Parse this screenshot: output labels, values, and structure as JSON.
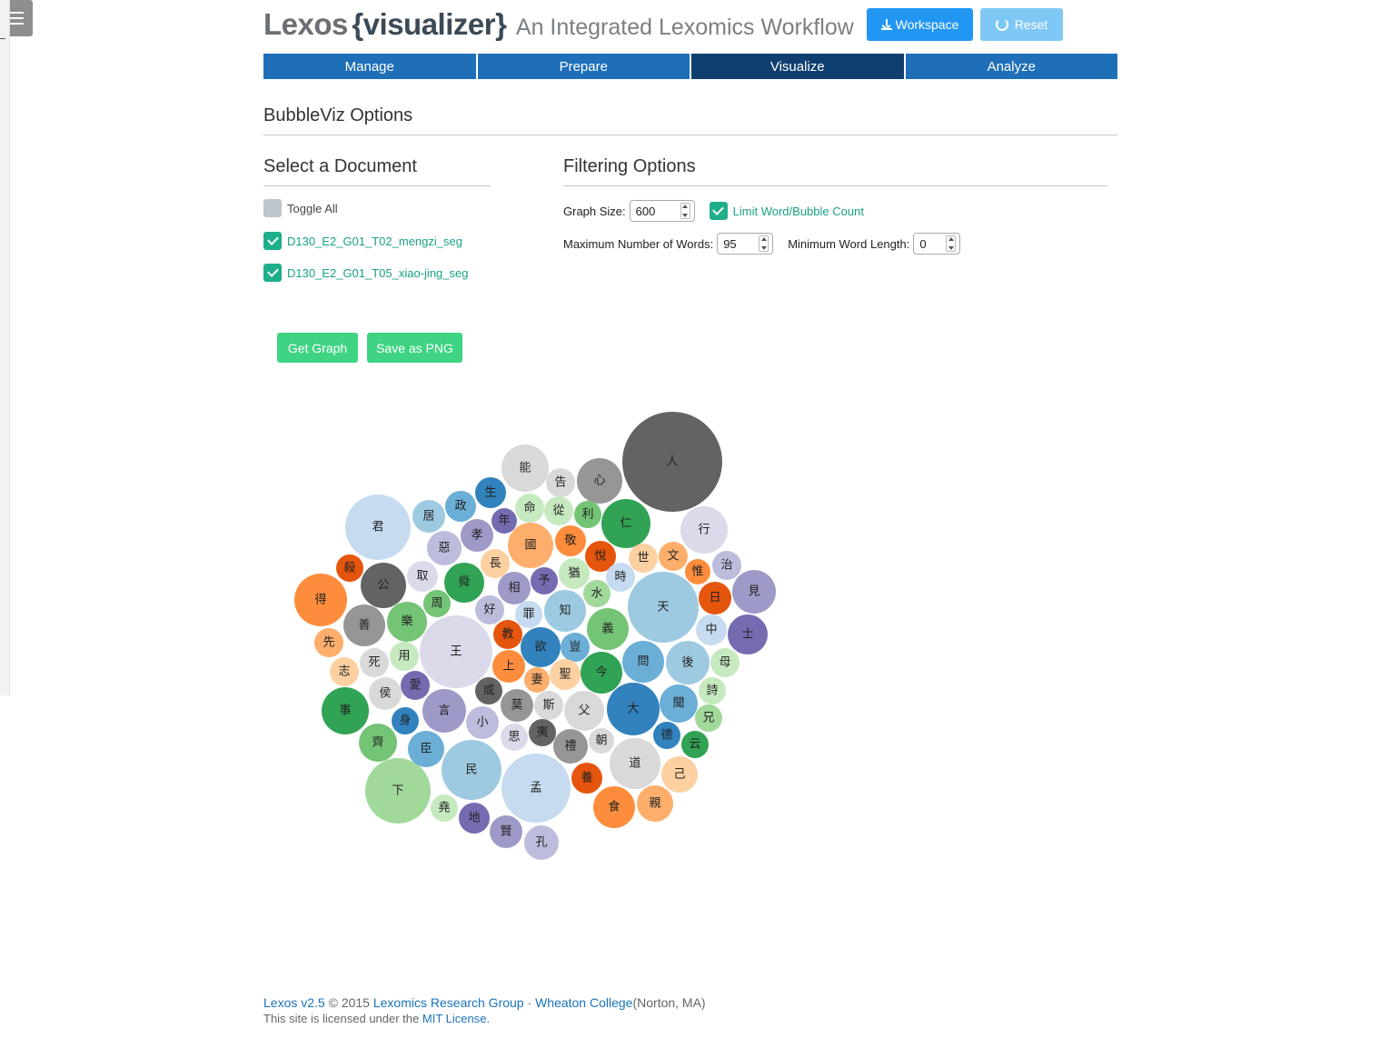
{
  "header": {
    "brand_name": "Lexos",
    "brand_module": "{visualizer}",
    "tagline": "An Integrated Lexomics Workflow",
    "workspace_label": "Workspace",
    "reset_label": "Reset"
  },
  "nav": {
    "tabs": [
      {
        "label": "Manage"
      },
      {
        "label": "Prepare"
      },
      {
        "label": "Visualize",
        "active": true
      },
      {
        "label": "Analyze"
      }
    ]
  },
  "page": {
    "title": "BubbleViz Options"
  },
  "documents": {
    "title": "Select a Document",
    "toggle_all_label": "Toggle All",
    "toggle_all_checked": false,
    "items": [
      {
        "label": "D130_E2_G01_T02_mengzi_seg",
        "checked": true
      },
      {
        "label": "D130_E2_G01_T05_xiao-jing_seg",
        "checked": true
      }
    ]
  },
  "filtering": {
    "title": "Filtering Options",
    "graph_size_label": "Graph Size:",
    "graph_size_value": "600",
    "limit_label": "Limit Word/Bubble Count",
    "limit_checked": true,
    "max_words_label": "Maximum Number of Words:",
    "max_words_value": "95",
    "min_length_label": "Minimum Word Length:",
    "min_length_value": "0"
  },
  "actions": {
    "get_graph_label": "Get Graph",
    "save_png_label": "Save as PNG"
  },
  "bubble_chart": {
    "colors": {
      "dark_gray": "#636363",
      "gray": "#969696",
      "light_gray": "#d9d9d9",
      "green": "#31a354",
      "mid_green": "#74c476",
      "light_green": "#a1d99b",
      "pale_green": "#c7e9c0",
      "blue": "#3182bd",
      "mid_blue": "#6baed6",
      "light_blue": "#9ecae1",
      "pale_blue": "#c6dbef",
      "orange_dark": "#e6550d",
      "orange": "#fd8d3c",
      "light_orange": "#fdae6b",
      "pale_orange": "#fdd0a2",
      "purple": "#756bb1",
      "mid_purple": "#9e9ac8",
      "light_purple": "#bcbddc",
      "pale_purple": "#dadaeb"
    },
    "words": [
      {
        "word": "人",
        "color": "dark_gray",
        "weight": 55
      },
      {
        "word": "王",
        "color": "pale_purple",
        "weight": 40
      },
      {
        "word": "孟",
        "color": "pale_blue",
        "weight": 38
      },
      {
        "word": "天",
        "color": "light_blue",
        "weight": 39
      },
      {
        "word": "下",
        "color": "light_green",
        "weight": 36
      },
      {
        "word": "君",
        "color": "pale_blue",
        "weight": 36
      },
      {
        "word": "民",
        "color": "light_blue",
        "weight": 33
      },
      {
        "word": "得",
        "color": "orange",
        "weight": 29
      },
      {
        "word": "仁",
        "color": "green",
        "weight": 27
      },
      {
        "word": "大",
        "color": "blue",
        "weight": 29
      },
      {
        "word": "道",
        "color": "light_gray",
        "weight": 28
      },
      {
        "word": "心",
        "color": "gray",
        "weight": 25
      },
      {
        "word": "能",
        "color": "light_gray",
        "weight": 26
      },
      {
        "word": "行",
        "color": "pale_purple",
        "weight": 26
      },
      {
        "word": "國",
        "color": "light_orange",
        "weight": 25
      },
      {
        "word": "事",
        "color": "green",
        "weight": 26
      },
      {
        "word": "公",
        "color": "dark_gray",
        "weight": 25
      },
      {
        "word": "言",
        "color": "mid_purple",
        "weight": 24
      },
      {
        "word": "後",
        "color": "light_blue",
        "weight": 24
      },
      {
        "word": "善",
        "color": "gray",
        "weight": 23
      },
      {
        "word": "問",
        "color": "mid_blue",
        "weight": 23
      },
      {
        "word": "今",
        "color": "green",
        "weight": 23
      },
      {
        "word": "見",
        "color": "mid_purple",
        "weight": 24
      },
      {
        "word": "舜",
        "color": "green",
        "weight": 22
      },
      {
        "word": "義",
        "color": "mid_green",
        "weight": 23
      },
      {
        "word": "知",
        "color": "light_blue",
        "weight": 23
      },
      {
        "word": "欲",
        "color": "blue",
        "weight": 22
      },
      {
        "word": "士",
        "color": "purple",
        "weight": 22
      },
      {
        "word": "樂",
        "color": "mid_green",
        "weight": 22
      },
      {
        "word": "食",
        "color": "orange",
        "weight": 23
      },
      {
        "word": "父",
        "color": "light_gray",
        "weight": 22
      },
      {
        "word": "聞",
        "color": "mid_blue",
        "weight": 21
      },
      {
        "word": "齊",
        "color": "mid_green",
        "weight": 21
      },
      {
        "word": "臣",
        "color": "mid_blue",
        "weight": 20
      },
      {
        "word": "親",
        "color": "light_orange",
        "weight": 20
      },
      {
        "word": "己",
        "color": "pale_orange",
        "weight": 20
      },
      {
        "word": "禮",
        "color": "gray",
        "weight": 19
      },
      {
        "word": "居",
        "color": "light_blue",
        "weight": 18
      },
      {
        "word": "惡",
        "color": "light_purple",
        "weight": 19
      },
      {
        "word": "孝",
        "color": "mid_purple",
        "weight": 18
      },
      {
        "word": "上",
        "color": "orange",
        "weight": 18
      },
      {
        "word": "相",
        "color": "mid_purple",
        "weight": 18
      },
      {
        "word": "小",
        "color": "light_purple",
        "weight": 18
      },
      {
        "word": "莫",
        "color": "gray",
        "weight": 18
      },
      {
        "word": "賢",
        "color": "mid_purple",
        "weight": 18
      },
      {
        "word": "孔",
        "color": "light_purple",
        "weight": 19
      },
      {
        "word": "日",
        "color": "orange_dark",
        "weight": 18
      },
      {
        "word": "政",
        "color": "mid_blue",
        "weight": 17
      },
      {
        "word": "生",
        "color": "blue",
        "weight": 17
      },
      {
        "word": "命",
        "color": "pale_green",
        "weight": 16
      },
      {
        "word": "年",
        "color": "purple",
        "weight": 14
      },
      {
        "word": "告",
        "color": "light_gray",
        "weight": 16
      },
      {
        "word": "從",
        "color": "pale_green",
        "weight": 16
      },
      {
        "word": "利",
        "color": "mid_green",
        "weight": 15
      },
      {
        "word": "敬",
        "color": "orange",
        "weight": 17
      },
      {
        "word": "悅",
        "color": "orange_dark",
        "weight": 17
      },
      {
        "word": "世",
        "color": "pale_orange",
        "weight": 16
      },
      {
        "word": "文",
        "color": "light_orange",
        "weight": 16
      },
      {
        "word": "治",
        "color": "light_purple",
        "weight": 16
      },
      {
        "word": "惟",
        "color": "orange",
        "weight": 14
      },
      {
        "word": "殺",
        "color": "orange_dark",
        "weight": 15
      },
      {
        "word": "取",
        "color": "pale_purple",
        "weight": 17
      },
      {
        "word": "周",
        "color": "mid_green",
        "weight": 15
      },
      {
        "word": "長",
        "color": "pale_orange",
        "weight": 16
      },
      {
        "word": "予",
        "color": "purple",
        "weight": 15
      },
      {
        "word": "猶",
        "color": "pale_green",
        "weight": 17
      },
      {
        "word": "時",
        "color": "pale_blue",
        "weight": 16
      },
      {
        "word": "水",
        "color": "light_green",
        "weight": 15
      },
      {
        "word": "好",
        "color": "light_purple",
        "weight": 16
      },
      {
        "word": "罪",
        "color": "pale_blue",
        "weight": 15
      },
      {
        "word": "中",
        "color": "pale_blue",
        "weight": 17
      },
      {
        "word": "先",
        "color": "light_orange",
        "weight": 16
      },
      {
        "word": "用",
        "color": "pale_green",
        "weight": 16
      },
      {
        "word": "死",
        "color": "light_gray",
        "weight": 16
      },
      {
        "word": "教",
        "color": "orange_dark",
        "weight": 16
      },
      {
        "word": "豈",
        "color": "mid_blue",
        "weight": 16
      },
      {
        "word": "母",
        "color": "pale_green",
        "weight": 16
      },
      {
        "word": "志",
        "color": "pale_orange",
        "weight": 16
      },
      {
        "word": "妻",
        "color": "light_orange",
        "weight": 14
      },
      {
        "word": "聖",
        "color": "pale_orange",
        "weight": 17
      },
      {
        "word": "愛",
        "color": "purple",
        "weight": 16
      },
      {
        "word": "侯",
        "color": "light_gray",
        "weight": 18
      },
      {
        "word": "或",
        "color": "dark_gray",
        "weight": 15
      },
      {
        "word": "斯",
        "color": "light_gray",
        "weight": 16
      },
      {
        "word": "詩",
        "color": "pale_green",
        "weight": 15
      },
      {
        "word": "身",
        "color": "blue",
        "weight": 15
      },
      {
        "word": "兄",
        "color": "light_green",
        "weight": 15
      },
      {
        "word": "思",
        "color": "pale_purple",
        "weight": 15
      },
      {
        "word": "夷",
        "color": "dark_gray",
        "weight": 15
      },
      {
        "word": "朝",
        "color": "light_gray",
        "weight": 14
      },
      {
        "word": "德",
        "color": "blue",
        "weight": 15
      },
      {
        "word": "云",
        "color": "green",
        "weight": 15
      },
      {
        "word": "養",
        "color": "orange_dark",
        "weight": 17
      },
      {
        "word": "堯",
        "color": "pale_green",
        "weight": 15
      },
      {
        "word": "地",
        "color": "purple",
        "weight": 17
      }
    ]
  },
  "footer": {
    "version": "Lexos v2.5",
    "copyright": "© 2015",
    "group": "Lexomics Research Group",
    "sep": "·",
    "college": "Wheaton College",
    "location": "(Norton, MA)",
    "license_prefix": "This site is licensed under the",
    "license_link": "MIT License."
  }
}
